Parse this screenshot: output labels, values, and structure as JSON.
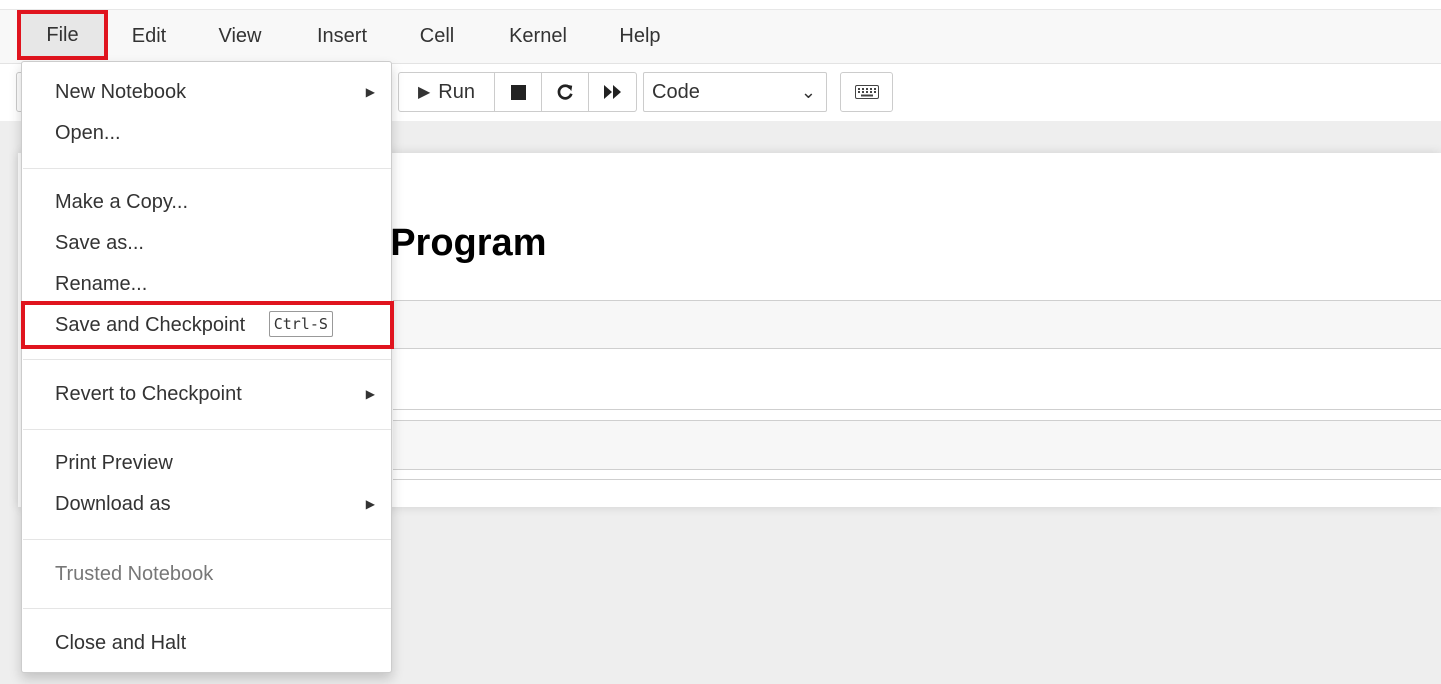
{
  "menubar": {
    "items": [
      "File",
      "Edit",
      "View",
      "Insert",
      "Cell",
      "Kernel",
      "Help"
    ],
    "active": "File"
  },
  "toolbar": {
    "run_label": "Run",
    "celltype_value": "Code"
  },
  "notebook": {
    "heading_partial": "t Program"
  },
  "file_menu": {
    "new_notebook": "New Notebook",
    "open": "Open...",
    "make_copy": "Make a Copy...",
    "save_as": "Save as...",
    "rename": "Rename...",
    "save_checkpoint": "Save and Checkpoint",
    "save_checkpoint_shortcut": "Ctrl-S",
    "revert_checkpoint": "Revert to Checkpoint",
    "print_preview": "Print Preview",
    "download_as": "Download as",
    "trusted_notebook": "Trusted Notebook",
    "close_halt": "Close and Halt"
  },
  "colors": {
    "highlight": "#e0141e",
    "menubar_bg": "#f8f8f8"
  }
}
